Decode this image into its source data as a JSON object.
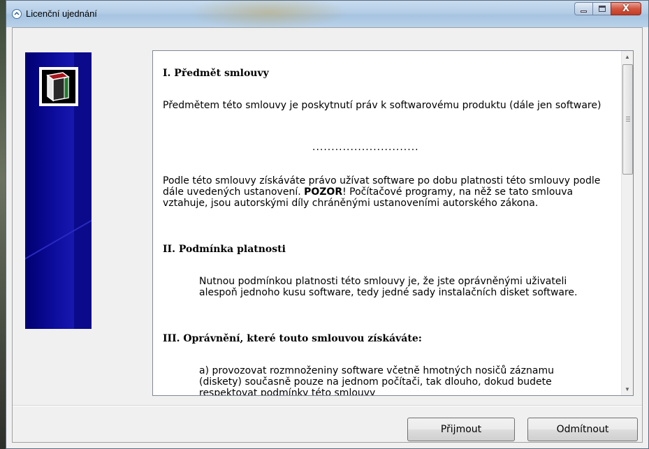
{
  "window": {
    "title": "Licenční ujednání",
    "close_glyph": "X"
  },
  "license": {
    "s1_heading": "I. Předmět smlouvy",
    "s1_p1": "Předmětem této smlouvy je poskytnutí práv k softwarovému produktu (dále jen software)",
    "separator": "............................",
    "s1_p2_before": "Podle této smlouvy získáváte právo užívat software po dobu platnosti této smlouvy podle dále uvedených ustanovení. ",
    "s1_p2_bold": "POZOR",
    "s1_p2_after": "! Počítačové programy, na něž se tato smlouva vztahuje, jsou autorskými díly chráněnými ustanoveními autorského zákona.",
    "s2_heading": "II. Podmínka platnosti",
    "s2_p1": "Nutnou podmínkou platnosti této smlouvy je, že jste oprávněnými uživateli alespoň jednoho kusu software, tedy jedné sady instalačních disket software.",
    "s3_heading": "III. Oprávnění, které touto smlouvou získáváte:",
    "s3_a": "a) provozovat rozmnoženiny software včetně hmotných nosičů záznamu (diskety) současně pouze na jednom počítači, tak dlouho, dokud budete respektovat podmínky této smlouvy"
  },
  "buttons": {
    "accept": "Přijmout",
    "decline": "Odmítnout"
  }
}
